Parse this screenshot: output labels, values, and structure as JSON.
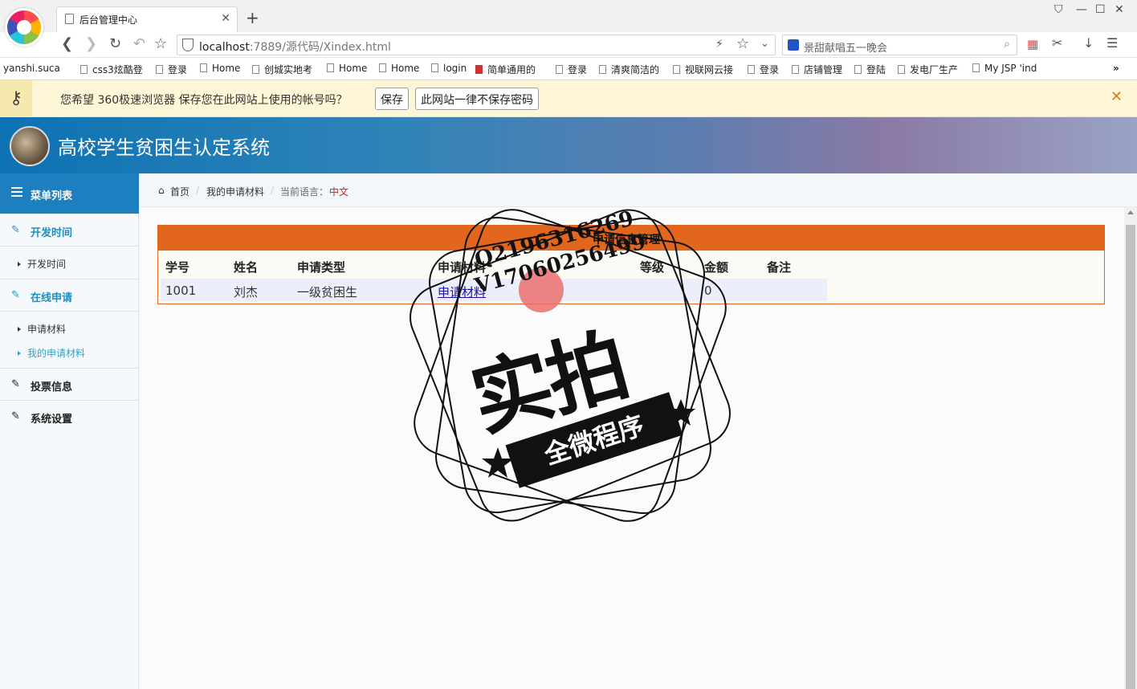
{
  "browser": {
    "tab_title": "后台管理中心",
    "url_host": "localhost",
    "url_rest": ":7889/源代码/Xindex.html",
    "search_text": "景甜献唱五一晚会",
    "bookmarks": [
      "yanshi.suca",
      "css3炫酷登",
      "登录",
      "Home",
      "创城实地考",
      "Home",
      "Home",
      "login",
      "简单通用的",
      "登录",
      "清爽简洁的",
      "视联网云接",
      "登录",
      "店铺管理",
      "登陆",
      "发电厂生产",
      "My JSP 'ind"
    ],
    "password_prompt": "您希望 360极速浏览器 保存您在此网站上使用的帐号吗？",
    "save_label": "保存",
    "never_save_label": "此网站一律不保存密码"
  },
  "app": {
    "title": "高校学生贫困生认定系统"
  },
  "sidebar": {
    "header": "菜单列表",
    "groups": [
      {
        "label": "开发时间",
        "items": [
          "开发时间"
        ]
      },
      {
        "label": "在线申请",
        "items": [
          "申请材料",
          "我的申请材料"
        ]
      },
      {
        "label": "投票信息",
        "items": []
      },
      {
        "label": "系统设置",
        "items": []
      }
    ]
  },
  "breadcrumb": {
    "home": "首页",
    "current": "我的申请材料",
    "lang_label": "当前语言：",
    "lang_value": "中文"
  },
  "panel": {
    "title": "申请信息管理",
    "headers": [
      "学号",
      "姓名",
      "申请类型",
      "申请材料",
      "等级",
      "金额",
      "备注"
    ],
    "rows": [
      {
        "id": "1001",
        "name": "刘杰",
        "type": "一级贫困生",
        "material": "申请材料",
        "level": "",
        "amount": "0",
        "note": ""
      }
    ]
  },
  "watermark": {
    "line1": "Q2196316269",
    "line2": "V17060256499",
    "big": "实拍",
    "ribbon": "全微程序"
  }
}
